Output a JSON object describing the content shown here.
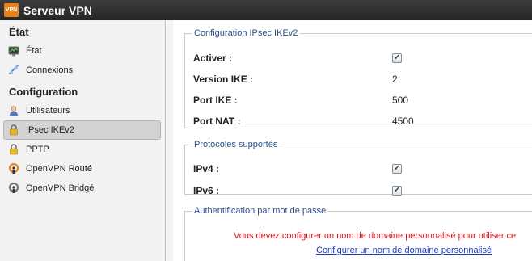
{
  "window": {
    "title": "Serveur VPN",
    "icon_text": "VPN"
  },
  "sidebar": {
    "sections": [
      {
        "label": "État",
        "items": [
          {
            "label": "État",
            "icon": "monitor-icon"
          },
          {
            "label": "Connexions",
            "icon": "connection-icon"
          }
        ]
      },
      {
        "label": "Configuration",
        "items": [
          {
            "label": "Utilisateurs",
            "icon": "user-icon"
          },
          {
            "label": "IPsec IKEv2",
            "icon": "lock-icon",
            "active": true
          },
          {
            "label": "PPTP",
            "icon": "lock-icon"
          },
          {
            "label": "OpenVPN Routé",
            "icon": "openvpn-icon"
          },
          {
            "label": "OpenVPN Bridgé",
            "icon": "openvpn-bridge-icon"
          }
        ]
      }
    ]
  },
  "config": {
    "legend": "Configuration IPsec IKEv2",
    "enable_label": "Activer :",
    "enable_checked": true,
    "ike_version_label": "Version IKE :",
    "ike_version_value": "2",
    "ike_port_label": "Port IKE :",
    "ike_port_value": "500",
    "nat_port_label": "Port NAT :",
    "nat_port_value": "4500"
  },
  "protocols": {
    "legend": "Protocoles supportés",
    "ipv4_label": "IPv4 :",
    "ipv4_checked": true,
    "ipv6_label": "IPv6 :",
    "ipv6_checked": true
  },
  "auth": {
    "legend": "Authentification par mot de passe",
    "warning": "Vous devez configurer un nom de domaine personnalisé pour utiliser ce",
    "link": "Configurer un nom de domaine personnalisé"
  },
  "colors": {
    "accent": "#2c4f86",
    "warning": "#e01212",
    "link": "#1a3dbe",
    "titlebar": "#2f2f2f"
  }
}
